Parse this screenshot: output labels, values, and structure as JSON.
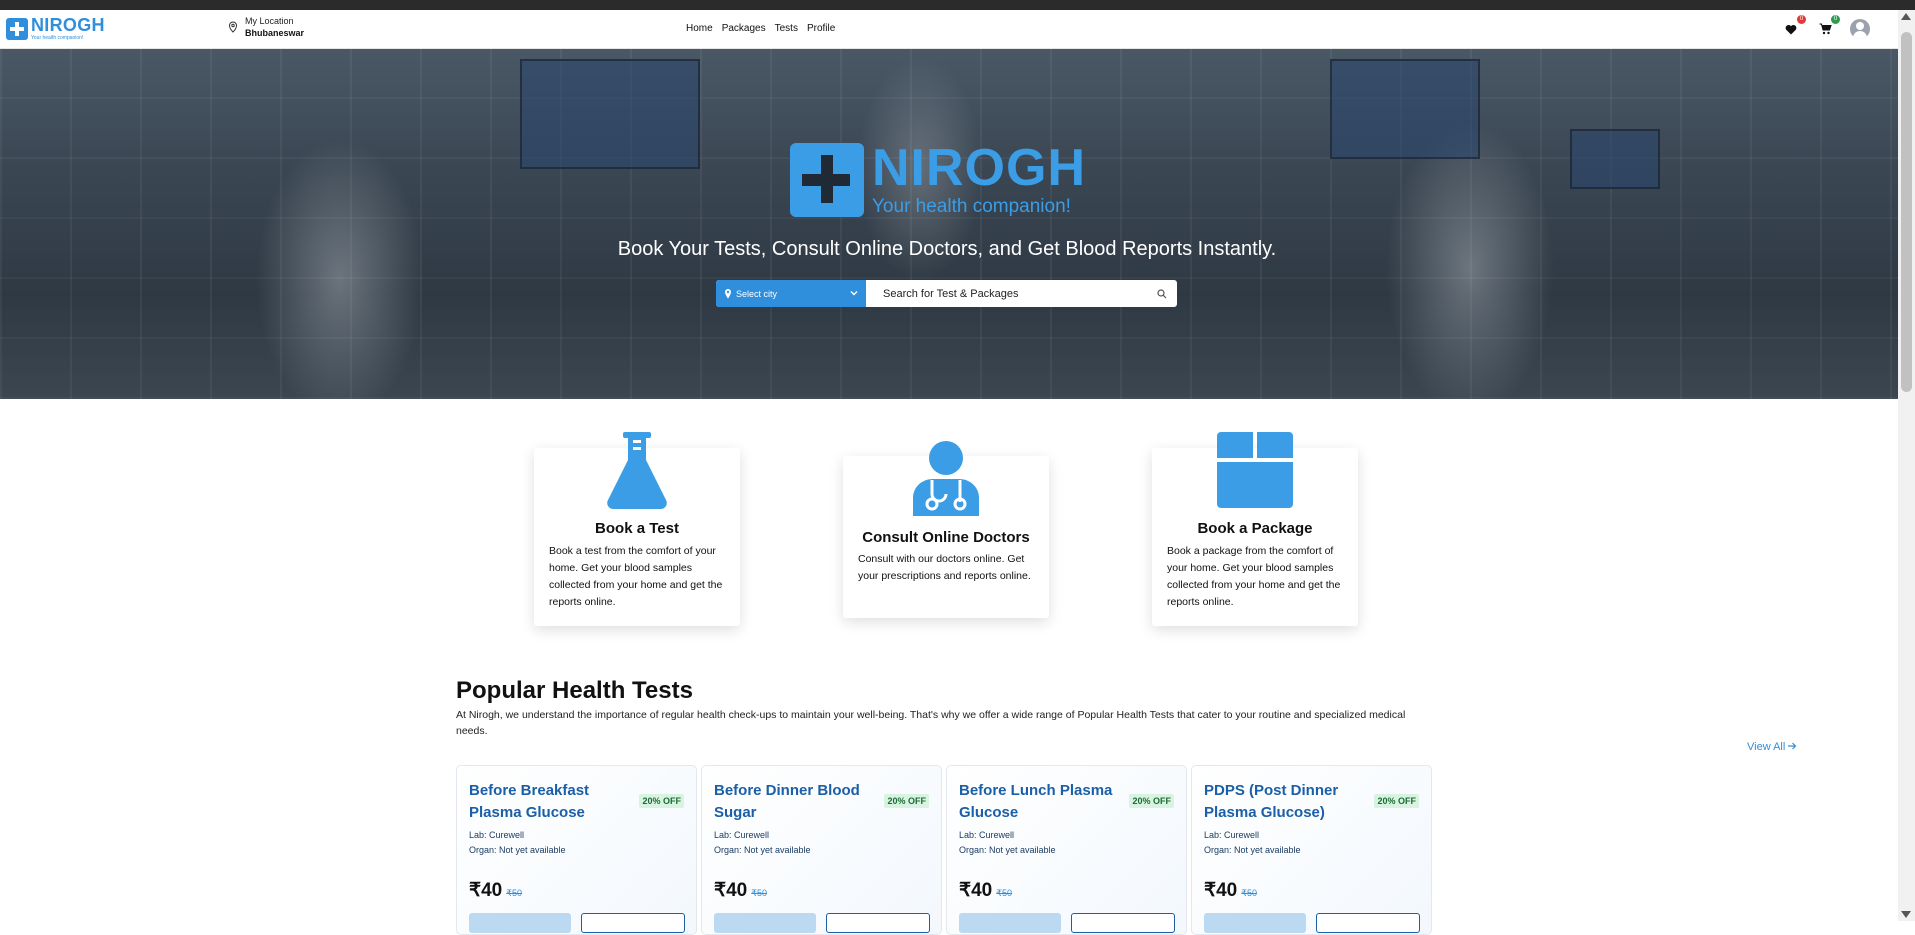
{
  "header": {
    "logo_name": "NIROGH",
    "logo_tagline": "Your health companion!",
    "location_label": "My Location",
    "location_value": "Bhubaneswar",
    "nav": [
      "Home",
      "Packages",
      "Tests",
      "Profile"
    ],
    "wishlist_count": "0",
    "cart_count": "0"
  },
  "hero": {
    "logo_name": "NIROGH",
    "logo_tagline": "Your health companion!",
    "tagline": "Book Your Tests, Consult Online Doctors, and Get Blood Reports Instantly.",
    "city_placeholder": "Select city",
    "search_placeholder": "Search for Test & Packages"
  },
  "services": [
    {
      "title": "Book a Test",
      "text": "Book a test from the comfort of your home. Get your blood samples collected from your home and get the reports online.",
      "icon": "flask-icon"
    },
    {
      "title": "Consult Online Doctors",
      "text": "Consult with our doctors online. Get your prescriptions and reports online.",
      "icon": "doctor-icon"
    },
    {
      "title": "Book a Package",
      "text": "Book a package from the comfort of your home. Get your blood samples collected from your home and get the reports online.",
      "icon": "package-icon"
    }
  ],
  "popular": {
    "title": "Popular Health Tests",
    "description": "At Nirogh, we understand the importance of regular health check-ups to maintain your well-being. That's why we offer a wide range of Popular Health Tests that cater to your routine and specialized medical needs.",
    "view_all": "View All",
    "tests": [
      {
        "name": "Before Breakfast Plasma Glucose",
        "discount": "20% OFF",
        "lab": "Lab: Curewell",
        "organ": "Organ: Not yet available",
        "price": "₹40",
        "old_price": "₹50"
      },
      {
        "name": "Before Dinner Blood Sugar",
        "discount": "20% OFF",
        "lab": "Lab: Curewell",
        "organ": "Organ: Not yet available",
        "price": "₹40",
        "old_price": "₹50"
      },
      {
        "name": "Before Lunch Plasma Glucose",
        "discount": "20% OFF",
        "lab": "Lab: Curewell",
        "organ": "Organ: Not yet available",
        "price": "₹40",
        "old_price": "₹50"
      },
      {
        "name": "PDPS (Post Dinner Plasma Glucose)",
        "discount": "20% OFF",
        "lab": "Lab: Curewell",
        "organ": "Organ: Not yet available",
        "price": "₹40",
        "old_price": "₹50"
      }
    ]
  },
  "colors": {
    "brand": "#2f8fdc",
    "discount_bg": "#d9f3e1",
    "test_title": "#1a5fa8"
  }
}
